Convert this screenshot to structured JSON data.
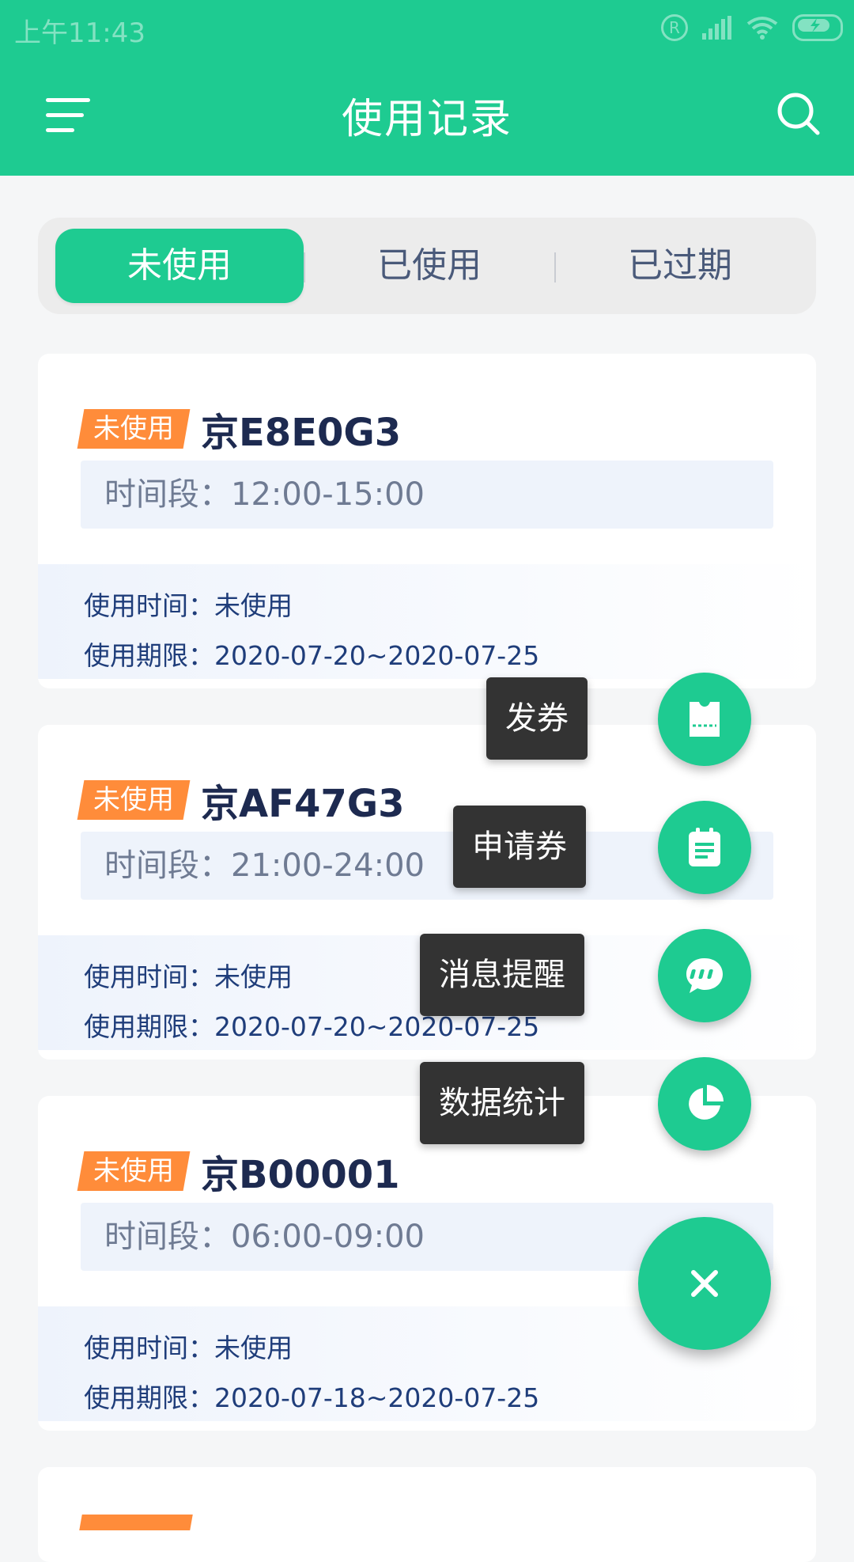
{
  "status_bar": {
    "time": "上午11:43",
    "icons": [
      "registered-icon",
      "signal-icon",
      "wifi-icon",
      "battery-charging-icon"
    ]
  },
  "app_bar": {
    "title": "使用记录",
    "menu_icon": "menu-icon",
    "search_icon": "search-icon",
    "color": "#1ecb91"
  },
  "tabs": [
    {
      "label": "未使用",
      "active": true
    },
    {
      "label": "已使用",
      "active": false
    },
    {
      "label": "已过期",
      "active": false
    }
  ],
  "cards": [
    {
      "badge": "未使用",
      "plate": "京E8E0G3",
      "timeslot": "时间段：12:00-15:00",
      "use_time": "使用时间：未使用",
      "valid_period": "使用期限：2020-07-20~2020-07-25"
    },
    {
      "badge": "未使用",
      "plate": "京AF47G3",
      "timeslot": "时间段：21:00-24:00",
      "use_time": "使用时间：未使用",
      "valid_period": "使用期限：2020-07-20~2020-07-25"
    },
    {
      "badge": "未使用",
      "plate": "京B00001",
      "timeslot": "时间段：06:00-09:00",
      "use_time": "使用时间：未使用",
      "valid_period": "使用期限：2020-07-18~2020-07-25"
    }
  ],
  "fab_menu": {
    "items": [
      {
        "label": "发券",
        "icon": "ticket-icon"
      },
      {
        "label": "申请券",
        "icon": "clipboard-icon"
      },
      {
        "label": "消息提醒",
        "icon": "chat-bubble-icon"
      },
      {
        "label": "数据统计",
        "icon": "pie-chart-icon"
      }
    ],
    "close_icon": "close-icon",
    "badge_color": "#ff8c3a"
  }
}
